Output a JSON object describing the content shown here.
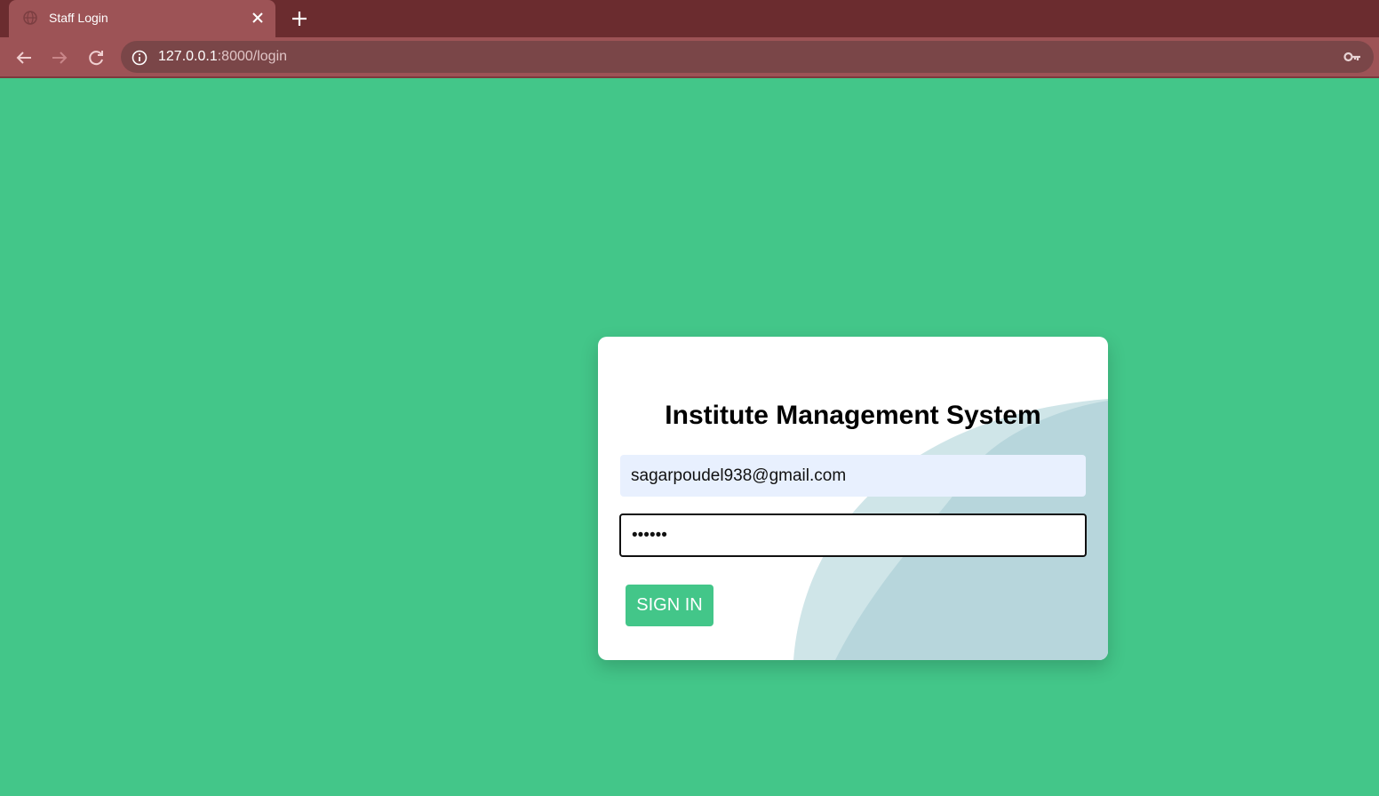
{
  "browser": {
    "tab_title": "Staff Login",
    "url_host": "127.0.0.1",
    "url_path": ":8000/login",
    "icons": {
      "favicon": "globe-icon",
      "close": "close-icon",
      "new_tab": "plus-icon",
      "back": "arrow-left-icon",
      "forward": "arrow-right-icon",
      "reload": "reload-icon",
      "info": "info-icon",
      "password": "key-icon"
    }
  },
  "login": {
    "title": "Institute Management System",
    "email_value": "sagarpoudel938@gmail.com",
    "password_value": "••••••",
    "sign_in_label": "SIGN IN"
  },
  "colors": {
    "page_background": "#43c689",
    "tab_strip": "#6b2c2f",
    "toolbar": "#9d5356",
    "button": "#43c689",
    "autofill": "#e8f0fe"
  }
}
